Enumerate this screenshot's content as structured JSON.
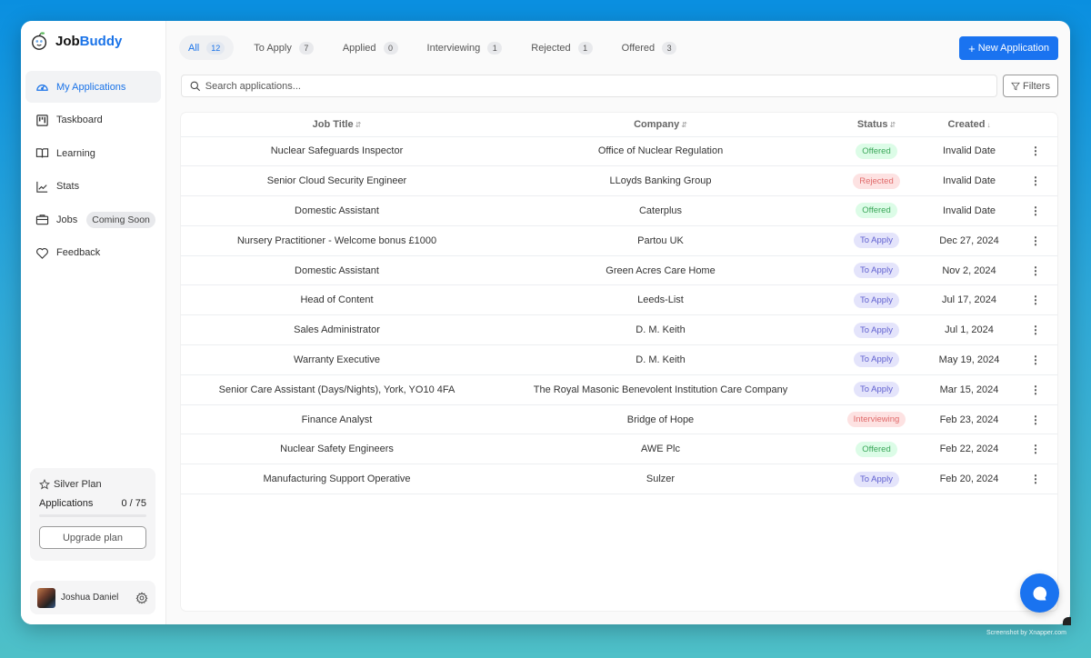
{
  "app": {
    "name_part1": "Job",
    "name_part2": "Buddy",
    "accent_color": "#1a73e8"
  },
  "sidebar": {
    "items": [
      {
        "label": "My Applications",
        "icon": "dashboard-gauge-icon",
        "active": true
      },
      {
        "label": "Taskboard",
        "icon": "kanban-icon"
      },
      {
        "label": "Learning",
        "icon": "book-icon"
      },
      {
        "label": "Stats",
        "icon": "line-chart-icon"
      },
      {
        "label": "Jobs",
        "icon": "briefcase-icon",
        "badge": "Coming Soon"
      },
      {
        "label": "Feedback",
        "icon": "heart-icon"
      }
    ],
    "plan": {
      "name": "Silver Plan",
      "applications_label": "Applications",
      "applications_value": "0 / 75",
      "usage_fraction": 0,
      "upgrade_label": "Upgrade plan"
    },
    "user": {
      "name": "Joshua Daniel"
    }
  },
  "tabs": [
    {
      "label": "All",
      "count": "12",
      "active": true
    },
    {
      "label": "To Apply",
      "count": "7"
    },
    {
      "label": "Applied",
      "count": "0"
    },
    {
      "label": "Interviewing",
      "count": "1"
    },
    {
      "label": "Rejected",
      "count": "1"
    },
    {
      "label": "Offered",
      "count": "3"
    }
  ],
  "toolbar": {
    "new_application_label": "New Application",
    "search_placeholder": "Search applications...",
    "filters_label": "Filters"
  },
  "table": {
    "columns": [
      {
        "label": "Job Title",
        "sort": "⇵"
      },
      {
        "label": "Company",
        "sort": "⇵"
      },
      {
        "label": "Status",
        "sort": "⇵"
      },
      {
        "label": "Created",
        "sort": "↓"
      }
    ],
    "rows": [
      {
        "title": "Nuclear Safeguards Inspector",
        "company": "Office of Nuclear Regulation",
        "status": "Offered",
        "created": "Invalid Date"
      },
      {
        "title": "Senior Cloud Security Engineer",
        "company": "LLoyds Banking Group",
        "status": "Rejected",
        "created": "Invalid Date"
      },
      {
        "title": "Domestic Assistant",
        "company": "Caterplus",
        "status": "Offered",
        "created": "Invalid Date"
      },
      {
        "title": "Nursery Practitioner - Welcome bonus £1000",
        "company": "Partou UK",
        "status": "To Apply",
        "created": "Dec 27, 2024"
      },
      {
        "title": "Domestic Assistant",
        "company": "Green Acres Care Home",
        "status": "To Apply",
        "created": "Nov 2, 2024"
      },
      {
        "title": "Head of Content",
        "company": "Leeds-List",
        "status": "To Apply",
        "created": "Jul 17, 2024"
      },
      {
        "title": "Sales Administrator",
        "company": "D. M. Keith",
        "status": "To Apply",
        "created": "Jul 1, 2024"
      },
      {
        "title": "Warranty Executive",
        "company": "D. M. Keith",
        "status": "To Apply",
        "created": "May 19, 2024"
      },
      {
        "title": "Senior Care Assistant (Days/Nights), York, YO10 4FA",
        "company": "The Royal Masonic Benevolent Institution Care Company",
        "status": "To Apply",
        "created": "Mar 15, 2024"
      },
      {
        "title": "Finance Analyst",
        "company": "Bridge of Hope",
        "status": "Interviewing",
        "created": "Feb 23, 2024"
      },
      {
        "title": "Nuclear Safety Engineers",
        "company": "AWE Plc",
        "status": "Offered",
        "created": "Feb 22, 2024"
      },
      {
        "title": "Manufacturing Support Operative",
        "company": "Sulzer",
        "status": "To Apply",
        "created": "Feb 20, 2024"
      }
    ],
    "status_colors": {
      "Offered": {
        "bg": "#dcfce7",
        "fg": "#3ba75a"
      },
      "Rejected": {
        "bg": "#fde2e2",
        "fg": "#e06b6b"
      },
      "To Apply": {
        "bg": "#e4e4fb",
        "fg": "#6060d0"
      },
      "Interviewing": {
        "bg": "#fde2e2",
        "fg": "#e06b6b"
      }
    }
  },
  "watermark": "Screenshot by Xnapper.com"
}
